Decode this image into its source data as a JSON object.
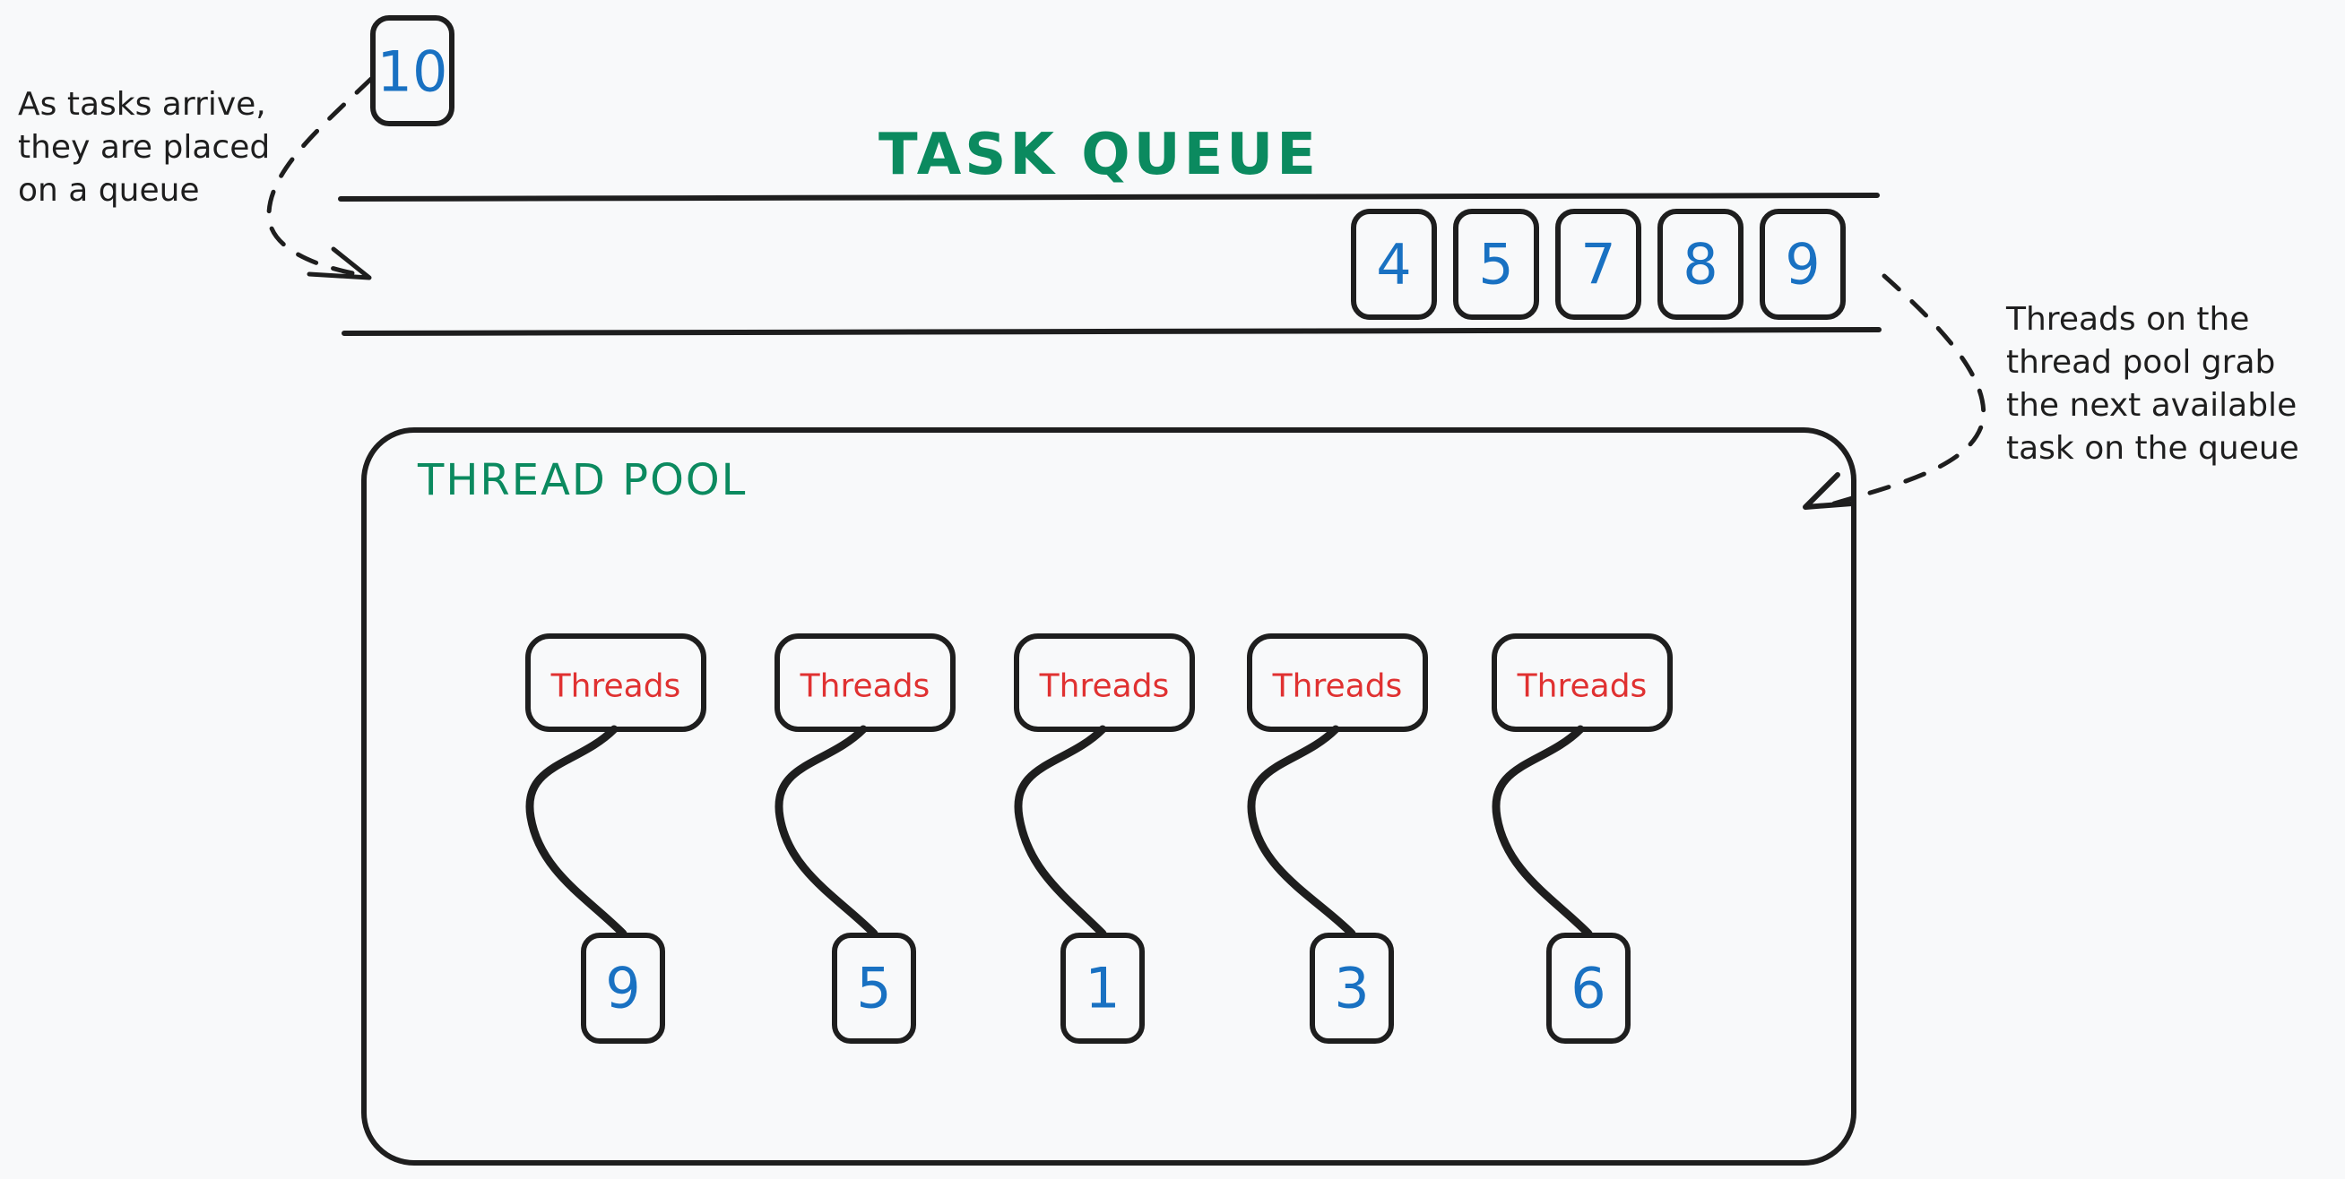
{
  "colors": {
    "background": "#f8f9fa",
    "stroke": "#1e1e1e",
    "title_green": "#0b8a5f",
    "task_blue": "#1971c2",
    "thread_red": "#e03131"
  },
  "incoming_task": {
    "value": "10"
  },
  "left_note": {
    "lines": [
      "As tasks arrive,",
      "they are placed",
      "on a queue"
    ]
  },
  "task_queue": {
    "title": "TASK QUEUE",
    "tasks": [
      "4",
      "5",
      "7",
      "8",
      "9"
    ]
  },
  "right_note": {
    "lines": [
      "Threads on the",
      "thread pool grab",
      "the next available",
      "task on the queue"
    ]
  },
  "thread_pool": {
    "title": "THREAD POOL",
    "threads": [
      {
        "label": "Threads",
        "task": "9"
      },
      {
        "label": "Threads",
        "task": "5"
      },
      {
        "label": "Threads",
        "task": "1"
      },
      {
        "label": "Threads",
        "task": "3"
      },
      {
        "label": "Threads",
        "task": "6"
      }
    ]
  }
}
